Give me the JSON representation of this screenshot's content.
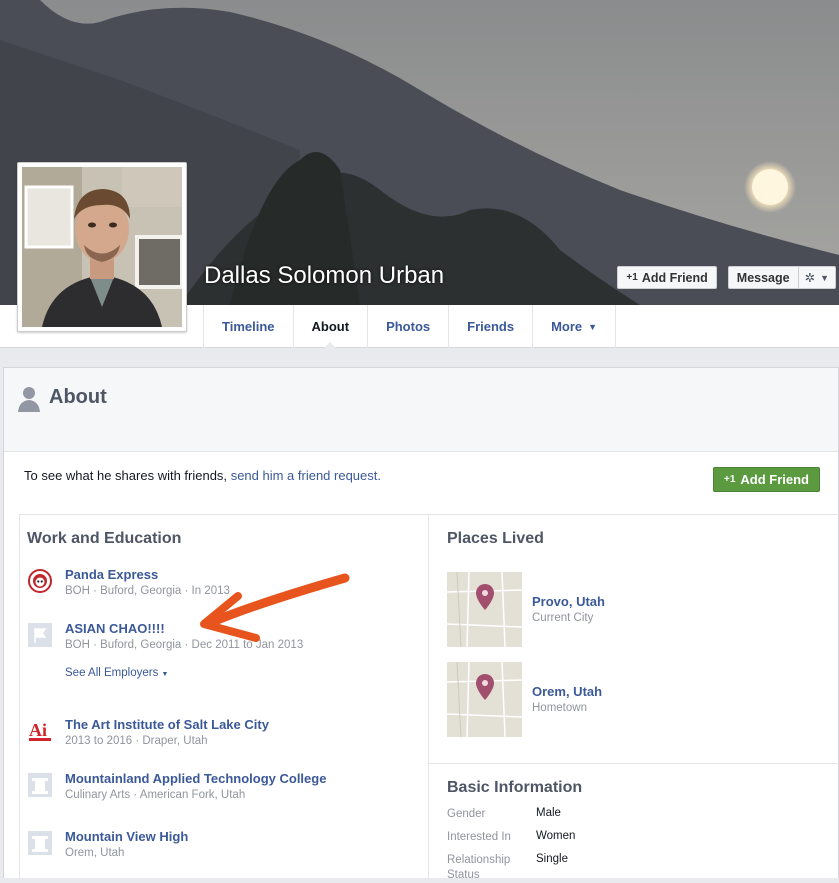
{
  "profile": {
    "name": "Dallas Solomon Urban",
    "add_friend_label": "Add Friend",
    "message_label": "Message"
  },
  "nav": {
    "tabs": [
      {
        "label": "Timeline"
      },
      {
        "label": "About"
      },
      {
        "label": "Photos"
      },
      {
        "label": "Friends"
      },
      {
        "label": "More"
      }
    ]
  },
  "about": {
    "title": "About",
    "friend_prompt_text": "To see what he shares with friends,",
    "friend_prompt_link": "send him a friend request.",
    "add_friend_label": "Add Friend"
  },
  "work_education": {
    "title": "Work and Education",
    "employers": [
      {
        "name": "Panda Express",
        "details": "BOH · Buford, Georgia · In 2013",
        "icon": "panda-express-logo"
      },
      {
        "name": "ASIAN CHAO!!!!",
        "details": "BOH · Buford, Georgia · Dec 2011 to Jan 2013",
        "icon": "page-flag-icon"
      }
    ],
    "see_all": "See All Employers",
    "schools": [
      {
        "name": "The Art Institute of Salt Lake City",
        "details": "2013 to 2016 · Draper, Utah",
        "icon": "art-institute-logo"
      },
      {
        "name": "Mountainland Applied Technology College",
        "details": "Culinary Arts · American Fork, Utah",
        "icon": "school-icon"
      },
      {
        "name": "Mountain View High",
        "details": "Orem, Utah",
        "icon": "school-icon"
      }
    ]
  },
  "places": {
    "title": "Places Lived",
    "items": [
      {
        "city": "Provo, Utah",
        "type": "Current City"
      },
      {
        "city": "Orem, Utah",
        "type": "Hometown"
      }
    ]
  },
  "basic_info": {
    "title": "Basic Information",
    "rows": [
      {
        "key": "Gender",
        "value": "Male"
      },
      {
        "key": "Interested In",
        "value": "Women"
      },
      {
        "key": "Relationship Status",
        "value": "Single"
      }
    ]
  },
  "colors": {
    "link": "#3b5998",
    "green_button": "#5b9a3f",
    "annotation_arrow": "#e8541e"
  }
}
